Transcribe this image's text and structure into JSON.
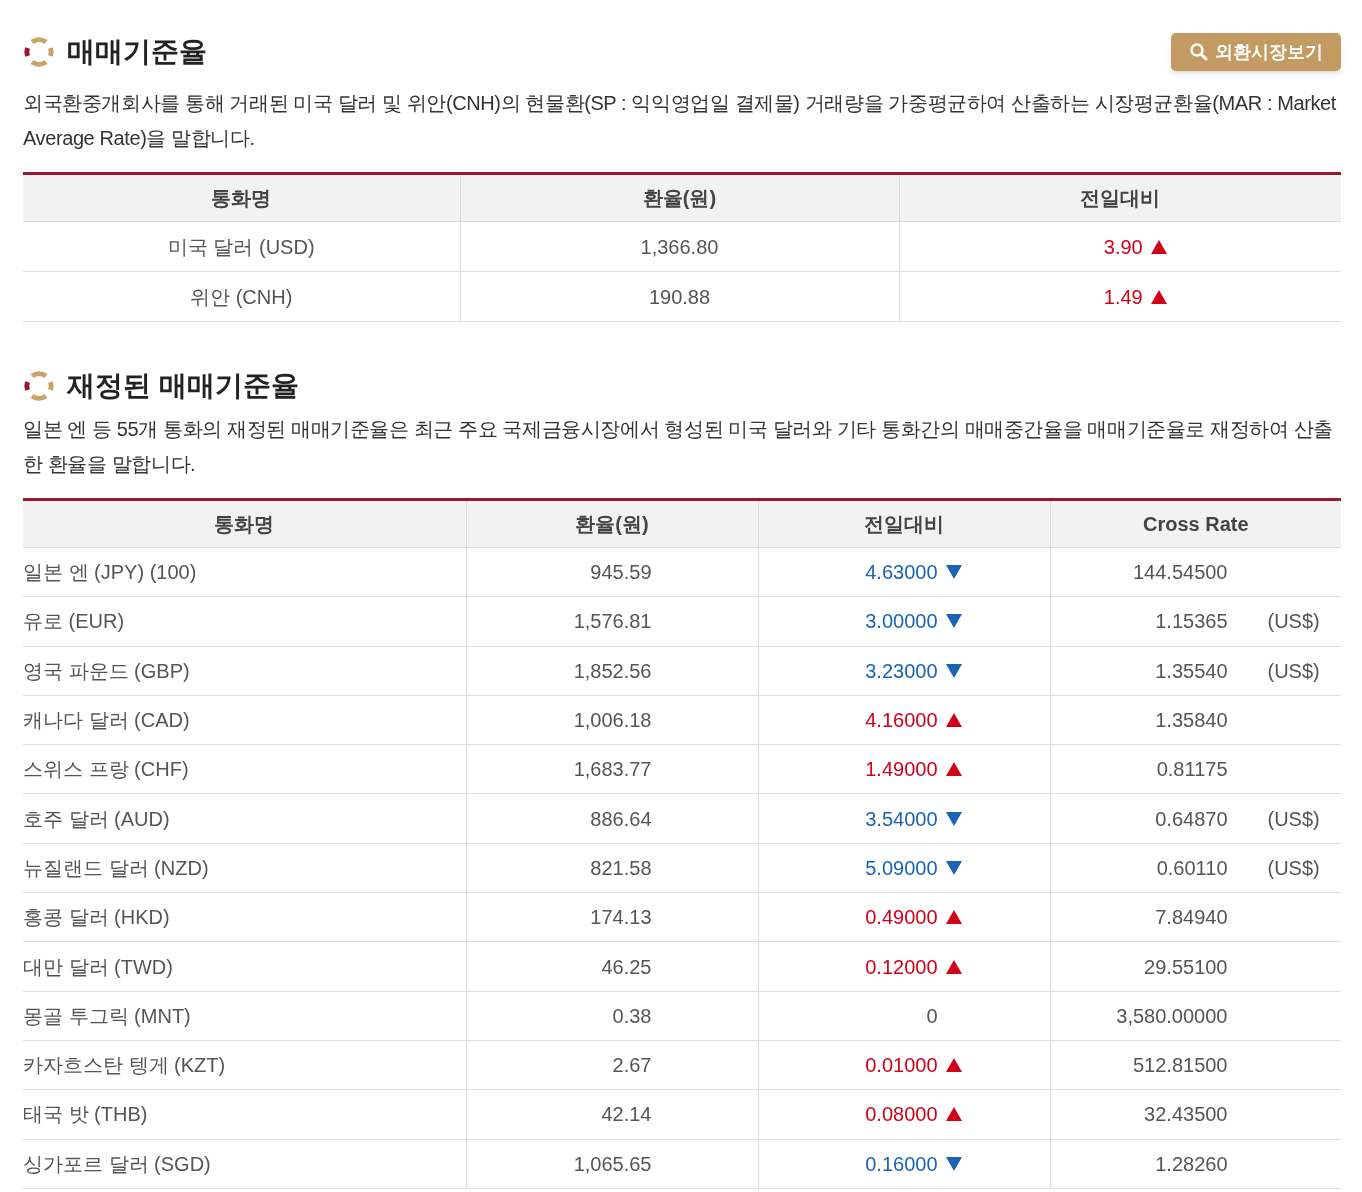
{
  "section_1": {
    "title": "매매기준율",
    "button": "외환시장보기",
    "description": "외국환중개회사를 통해 거래된 미국 달러 및 위안(CNH)의 현물환(SP : 익익영업일 결제물) 거래량을 가중평균하여 산출하는 시장평균환율(MAR : Market Average Rate)을 말합니다.",
    "table": {
      "columns": [
        "통화명",
        "환율(원)",
        "전일대비"
      ],
      "rows": [
        {
          "currency": "미국 달러 (USD)",
          "rate": "1,366.80",
          "change": "3.90",
          "kind": "up"
        },
        {
          "currency": "위안 (CNH)",
          "rate": "190.88",
          "change": "1.49",
          "kind": "up"
        }
      ]
    }
  },
  "section_2": {
    "title": "재정된 매매기준율",
    "description": "일본 엔 등 55개 통화의 재정된 매매기준율은 최근 주요 국제금융시장에서 형성된 미국 달러와 기타 통화간의 매매중간율을 매매기준율로 재정하여 산출한 환율을 말합니다.",
    "table": {
      "columns": [
        "통화명",
        "환율(원)",
        "전일대비",
        "Cross Rate"
      ],
      "rows": [
        {
          "currency": "일본 엔 (JPY) (100)",
          "rate": "945.59",
          "change": "4.63000",
          "kind": "down",
          "cross_rate": "144.54500"
        },
        {
          "currency": "유로 (EUR)",
          "rate": "1,576.81",
          "change": "3.00000",
          "kind": "down",
          "cross_rate": "1.15365",
          "unit": "(US$)"
        },
        {
          "currency": "영국 파운드 (GBP)",
          "rate": "1,852.56",
          "change": "3.23000",
          "kind": "down",
          "cross_rate": "1.35540",
          "unit": "(US$)"
        },
        {
          "currency": "캐나다 달러 (CAD)",
          "rate": "1,006.18",
          "change": "4.16000",
          "kind": "up",
          "cross_rate": "1.35840"
        },
        {
          "currency": "스위스 프랑 (CHF)",
          "rate": "1,683.77",
          "change": "1.49000",
          "kind": "up",
          "cross_rate": "0.81175"
        },
        {
          "currency": "호주 달러 (AUD)",
          "rate": "886.64",
          "change": "3.54000",
          "kind": "down",
          "cross_rate": "0.64870",
          "unit": "(US$)"
        },
        {
          "currency": "뉴질랜드 달러 (NZD)",
          "rate": "821.58",
          "change": "5.09000",
          "kind": "down",
          "cross_rate": "0.60110",
          "unit": "(US$)"
        },
        {
          "currency": "홍콩 달러 (HKD)",
          "rate": "174.13",
          "change": "0.49000",
          "kind": "up",
          "cross_rate": "7.84940"
        },
        {
          "currency": "대만 달러 (TWD)",
          "rate": "46.25",
          "change": "0.12000",
          "kind": "up",
          "cross_rate": "29.55100"
        },
        {
          "currency": "몽골 투그릭 (MNT)",
          "rate": "0.38",
          "change": "0",
          "kind": "none",
          "cross_rate": "3,580.00000"
        },
        {
          "currency": "카자흐스탄 텡게 (KZT)",
          "rate": "2.67",
          "change": "0.01000",
          "kind": "up",
          "cross_rate": "512.81500"
        },
        {
          "currency": "태국 밧 (THB)",
          "rate": "42.14",
          "change": "0.08000",
          "kind": "up",
          "cross_rate": "32.43500"
        },
        {
          "currency": "싱가포르 달러 (SGD)",
          "rate": "1,065.65",
          "change": "0.16000",
          "kind": "down",
          "cross_rate": "1.28260"
        }
      ]
    }
  }
}
